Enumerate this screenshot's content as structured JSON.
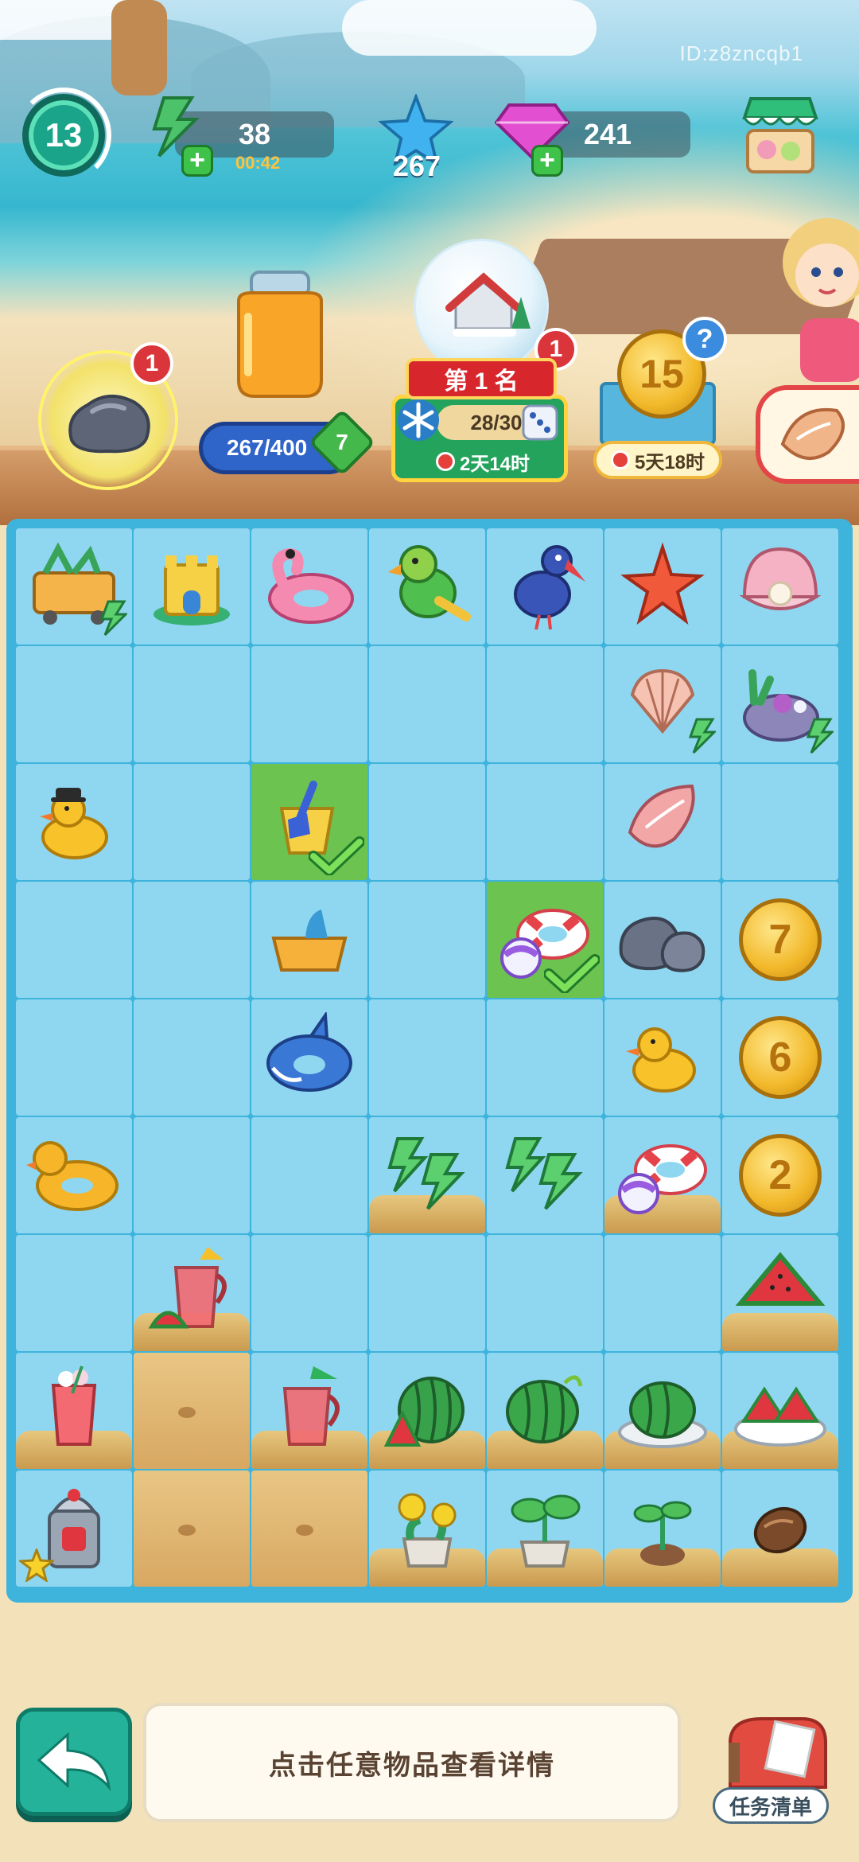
{
  "watermark": "ID:z8zncqb1",
  "topbar": {
    "level": "13",
    "energy": "38",
    "energy_timer": "00:42",
    "stars": "267",
    "gems": "241"
  },
  "features": {
    "rock_badge": "1",
    "jar_progress": "267/400",
    "jar_level": "7",
    "event_badge": "1",
    "event_rank": "第 1 名",
    "event_progress": "28/30",
    "event_timer": "2天14时",
    "coin_value": "15",
    "coin_help": "?",
    "coin_timer": "5天18时"
  },
  "board": {
    "cells": [
      [
        "surf-cart",
        "sand-castle",
        "flamingo-float",
        "parrot",
        "toucan",
        "starfish",
        "pearl-shell"
      ],
      [
        "",
        "",
        "",
        "",
        "",
        "scallop-shell",
        "coral-rock"
      ],
      [
        "rubber-duck-hat",
        "",
        "bucket-shovel",
        "",
        "",
        "conch-shell",
        ""
      ],
      [
        "",
        "",
        "sand-box",
        "",
        "swim-ring-ball",
        "rocks",
        "coin-7"
      ],
      [
        "",
        "",
        "shark-float",
        "",
        "",
        "rubber-duck",
        "coin-6"
      ],
      [
        "duck-float",
        "",
        "",
        "energy-bolts",
        "energy-bolts",
        "swim-ring-ball",
        "coin-2"
      ],
      [
        "",
        "watermelon-juice-pitcher",
        "",
        "",
        "",
        "",
        "watermelon-slices"
      ],
      [
        "fruit-drink",
        "sand",
        "juice-pitcher",
        "watermelon-half",
        "watermelon-whole",
        "watermelon-plate",
        "watermelon-platter"
      ],
      [
        "juicer",
        "sand",
        "sand",
        "flower-pot",
        "sprout-pot",
        "seedling",
        "seed"
      ]
    ],
    "coins": {
      "coin-7": "7",
      "coin-6": "6",
      "coin-2": "2"
    }
  },
  "bottom": {
    "hint": "点击任意物品查看详情",
    "task_label": "任务清单"
  },
  "colors": {
    "board_bg": "#3eb3dc",
    "cell_bg": "#8fd7f0",
    "selected_cell": "#6cc34f",
    "back_button": "#24b39a"
  }
}
